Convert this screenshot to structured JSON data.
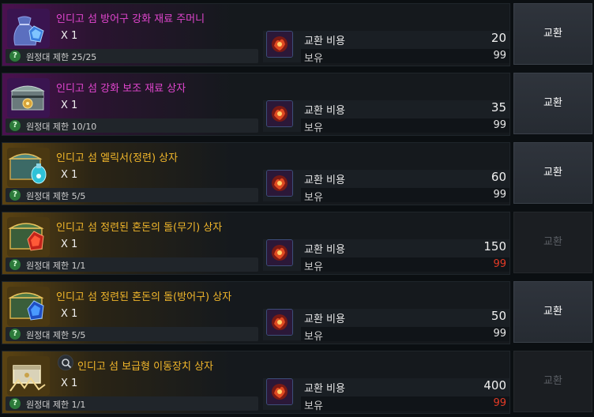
{
  "items": [
    {
      "name": "인디고 섬 방어구 강화 재료 주머니",
      "grade": "purple",
      "quantity": "X 1",
      "limit_label": "원정대 제한",
      "limit_value": "25/25",
      "cost_label": "교환 비용",
      "cost_value": "20",
      "own_label": "보유",
      "own_value": "99",
      "own_sufficient": true,
      "button_label": "교환",
      "button_enabled": true,
      "icon": "pouch-icon",
      "has_search": false
    },
    {
      "name": "인디고 섬 강화 보조 재료 상자",
      "grade": "purple",
      "quantity": "X 1",
      "limit_label": "원정대 제한",
      "limit_value": "10/10",
      "cost_label": "교환 비용",
      "cost_value": "35",
      "own_label": "보유",
      "own_value": "99",
      "own_sufficient": true,
      "button_label": "교환",
      "button_enabled": true,
      "icon": "chest-icon",
      "has_search": false
    },
    {
      "name": "인디고 섬 엘릭서(정련) 상자",
      "grade": "gold",
      "quantity": "X 1",
      "limit_label": "원정대 제한",
      "limit_value": "5/5",
      "cost_label": "교환 비용",
      "cost_value": "60",
      "own_label": "보유",
      "own_value": "99",
      "own_sufficient": true,
      "button_label": "교환",
      "button_enabled": true,
      "icon": "elixir-chest-icon",
      "has_search": false
    },
    {
      "name": "인디고 섬 정련된 혼돈의 돌(무기) 상자",
      "grade": "gold",
      "quantity": "X 1",
      "limit_label": "원정대 제한",
      "limit_value": "1/1",
      "cost_label": "교환 비용",
      "cost_value": "150",
      "own_label": "보유",
      "own_value": "99",
      "own_sufficient": false,
      "button_label": "교환",
      "button_enabled": false,
      "icon": "red-gem-chest-icon",
      "has_search": false
    },
    {
      "name": "인디고 섬 정련된 혼돈의 돌(방어구) 상자",
      "grade": "gold",
      "quantity": "X 1",
      "limit_label": "원정대 제한",
      "limit_value": "5/5",
      "cost_label": "교환 비용",
      "cost_value": "50",
      "own_label": "보유",
      "own_value": "99",
      "own_sufficient": true,
      "button_label": "교환",
      "button_enabled": true,
      "icon": "blue-gem-chest-icon",
      "has_search": false
    },
    {
      "name": "인디고 섬 보급형 이동장치 상자",
      "grade": "gold",
      "quantity": "X 1",
      "limit_label": "원정대 제한",
      "limit_value": "1/1",
      "cost_label": "교환 비용",
      "cost_value": "400",
      "own_label": "보유",
      "own_value": "99",
      "own_sufficient": false,
      "button_label": "교환",
      "button_enabled": false,
      "icon": "mount-chest-icon",
      "has_search": true
    }
  ],
  "colors": {
    "purple_grade": "#e246cf",
    "gold_grade": "#f2b72b",
    "insufficient": "#e33a26"
  },
  "help_glyph": "?"
}
